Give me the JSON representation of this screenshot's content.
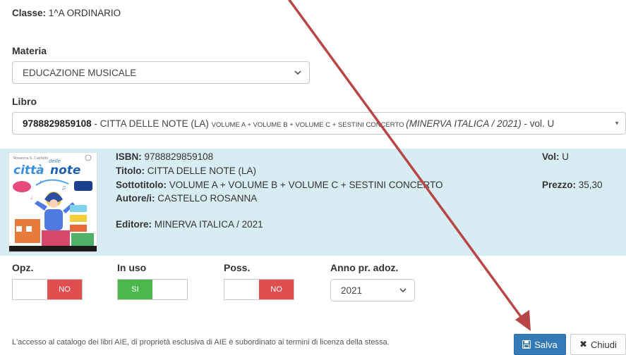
{
  "header": {
    "classe_label": "Classe:",
    "classe_value": "1^A ORDINARIO"
  },
  "materia": {
    "label": "Materia",
    "selected": "EDUCAZIONE MUSICALE"
  },
  "libro": {
    "label": "Libro",
    "isbn": "9788829859108",
    "sep1": " - ",
    "title": "CITTA DELLE NOTE (LA) ",
    "subtitle": "VOLUME A + VOLUME B + VOLUME C + SESTINI CONCERTO ",
    "publisher": "(MINERVA ITALICA / 2021)",
    "volume": " - vol. U"
  },
  "book": {
    "cover_title_small": "delle",
    "cover_title_a": "città",
    "cover_title_b": "note",
    "cover_author": "Rosanna S. Castello",
    "isbn_label": "ISBN:",
    "isbn_value": "9788829859108",
    "titolo_label": "Titolo:",
    "titolo_value": "CITTA DELLE NOTE (LA)",
    "sottotitolo_label": "Sottotitolo:",
    "sottotitolo_value": "VOLUME A + VOLUME B + VOLUME C + SESTINI CONCERTO",
    "autore_label": "Autore/i:",
    "autore_value": "CASTELLO ROSANNA",
    "editore_label": "Editore:",
    "editore_value": "MINERVA ITALICA / 2021",
    "vol_label": "Vol:",
    "vol_value": "U",
    "prezzo_label": "Prezzo:",
    "prezzo_value": "35,30"
  },
  "options": {
    "opz": {
      "label": "Opz.",
      "state": "NO"
    },
    "in_uso": {
      "label": "In uso",
      "state": "SI"
    },
    "poss": {
      "label": "Poss.",
      "state": "NO"
    },
    "anno": {
      "label": "Anno pr. adoz.",
      "selected": "2021"
    }
  },
  "footer": {
    "notice": "L'accesso al catalogo dei libri AIE, di proprietà esclusiva di AIE è subordinato ai termini di licenza della stessa.",
    "save_label": "Salva",
    "close_label": "Chiudi"
  },
  "colors": {
    "panel_bg": "#d7ecf3",
    "toggle_no": "#e04f4f",
    "toggle_si": "#4cb84c",
    "save_btn": "#337ab7",
    "arrow": "#b84646"
  }
}
